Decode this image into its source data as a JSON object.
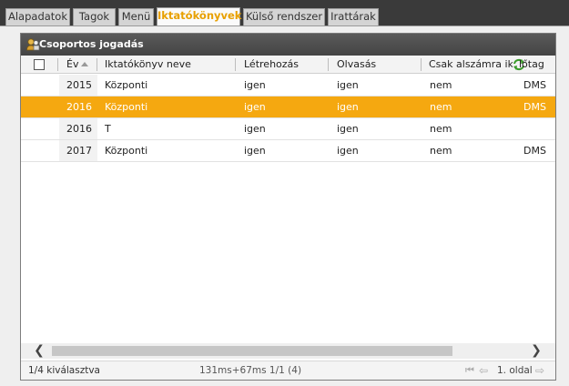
{
  "tabs": [
    {
      "label": "Alapadatok",
      "active": false
    },
    {
      "label": "Tagok",
      "active": false
    },
    {
      "label": "Menü",
      "active": false
    },
    {
      "label": "Iktatókönyvek",
      "active": true
    },
    {
      "label": "Külső rendszer",
      "active": false
    },
    {
      "label": "Irattárak",
      "active": false
    }
  ],
  "panel": {
    "title": "Csoportos jogadás"
  },
  "columns": {
    "year": "Év",
    "name": "Iktatókönyv neve",
    "create": "Létrehozás",
    "read": "Olvasás",
    "only_for": "Csak alszámra ik...",
    "source": "lőtag"
  },
  "rows": [
    {
      "year": "2015",
      "name": "Központi",
      "create": "igen",
      "read": "igen",
      "only_for": "nem",
      "source": "DMS",
      "selected": false
    },
    {
      "year": "2016",
      "name": "Központi",
      "create": "igen",
      "read": "igen",
      "only_for": "nem",
      "source": "DMS",
      "selected": true
    },
    {
      "year": "2016",
      "name": "T",
      "create": "igen",
      "read": "igen",
      "only_for": "nem",
      "source": "",
      "selected": false
    },
    {
      "year": "2017",
      "name": "Központi",
      "create": "igen",
      "read": "igen",
      "only_for": "nem",
      "source": "DMS",
      "selected": false
    }
  ],
  "footer": {
    "selection": "1/4 kiválasztva",
    "timing": "131ms+67ms 1/1 (4)",
    "page": "1. oldal"
  },
  "icons": {
    "header_icon": "group-rights-icon",
    "refresh": "refresh-icon",
    "scroll_left": "chevron-left-icon",
    "scroll_right": "chevron-right-icon",
    "first_page": "first-page-icon",
    "prev_page": "prev-page-icon",
    "next_page": "next-page-icon"
  },
  "colors": {
    "accent": "#f5a810",
    "active_tab_text": "#e8a000",
    "header_bg": "#4a4a4a"
  }
}
